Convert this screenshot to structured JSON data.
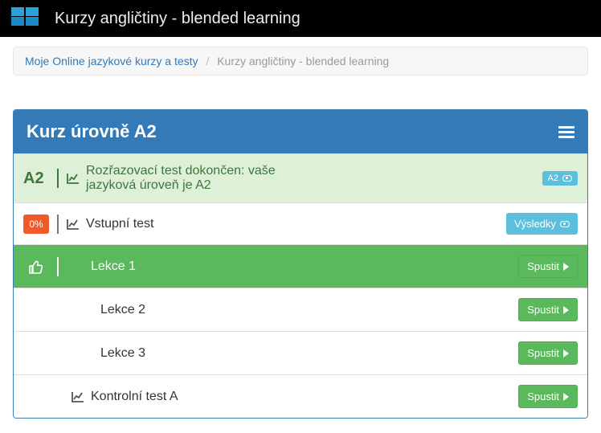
{
  "topbar": {
    "title": "Kurzy angličtiny - blended learning"
  },
  "breadcrumb": {
    "home": "Moje Online jazykové kurzy a testy",
    "current": "Kurzy angličtiny - blended learning"
  },
  "panel": {
    "title": "Kurz úrovně A2"
  },
  "rows": {
    "placement": {
      "badge": "A2",
      "label": "Rozřazovací test dokončen: vaše jazyková úroveň je A2",
      "button": "A2"
    },
    "entry": {
      "percent": "0%",
      "label": "Vstupní test",
      "button": "Výsledky"
    },
    "lesson1": {
      "label": "Lekce 1",
      "button": "Spustit"
    },
    "lesson2": {
      "label": "Lekce 2",
      "button": "Spustit"
    },
    "lesson3": {
      "label": "Lekce 3",
      "button": "Spustit"
    },
    "testA": {
      "label": "Kontrolní test A",
      "button": "Spustit"
    }
  }
}
